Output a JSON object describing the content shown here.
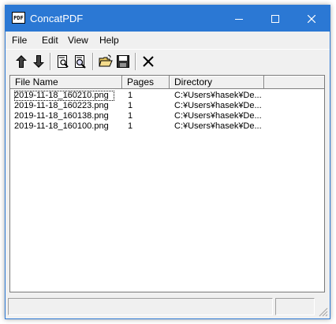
{
  "window": {
    "title": "ConcatPDF",
    "icon_text": "PDF",
    "title_bar_color": "#2b78d4"
  },
  "menu": [
    "File",
    "Edit",
    "View",
    "Help"
  ],
  "toolbar": {
    "buttons": [
      {
        "icon": "move-up-icon"
      },
      {
        "icon": "move-down-icon"
      },
      {
        "icon": "preview-icon"
      },
      {
        "icon": "zoom-preview-icon"
      },
      {
        "icon": "open-folder-icon"
      },
      {
        "icon": "save-icon"
      },
      {
        "icon": "delete-icon"
      }
    ]
  },
  "list": {
    "columns": [
      "File Name",
      "Pages",
      "Directory"
    ],
    "rows": [
      {
        "file": "2019-11-18_160210.png",
        "pages": "1",
        "dir": "C:¥Users¥hasek¥De..."
      },
      {
        "file": "2019-11-18_160223.png",
        "pages": "1",
        "dir": "C:¥Users¥hasek¥De..."
      },
      {
        "file": "2019-11-18_160138.png",
        "pages": "1",
        "dir": "C:¥Users¥hasek¥De..."
      },
      {
        "file": "2019-11-18_160100.png",
        "pages": "1",
        "dir": "C:¥Users¥hasek¥De..."
      }
    ]
  }
}
